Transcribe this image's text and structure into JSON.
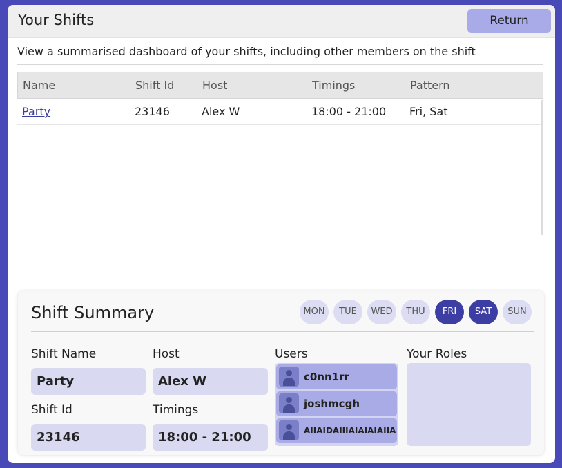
{
  "header": {
    "title": "Your Shifts",
    "return_label": "Return"
  },
  "subtitle": "View a summarised dashboard of your shifts, including other members on the shift",
  "table": {
    "columns": [
      "Name",
      "Shift Id",
      "Host",
      "Timings",
      "Pattern"
    ],
    "rows": [
      [
        "Party",
        "23146",
        "Alex W",
        "18:00 - 21:00",
        "Fri, Sat"
      ]
    ]
  },
  "summary": {
    "title": "Shift Summary",
    "days": [
      {
        "label": "MON",
        "active": false
      },
      {
        "label": "TUE",
        "active": false
      },
      {
        "label": "WED",
        "active": false
      },
      {
        "label": "THU",
        "active": false
      },
      {
        "label": "FRI",
        "active": true
      },
      {
        "label": "SAT",
        "active": true
      },
      {
        "label": "SUN",
        "active": false
      }
    ],
    "shift_name_label": "Shift Name",
    "shift_name": "Party",
    "host_label": "Host",
    "host": "Alex W",
    "shift_id_label": "Shift Id",
    "shift_id": "23146",
    "timings_label": "Timings",
    "timings": "18:00 - 21:00",
    "users_label": "Users",
    "users": [
      "c0nn1rr",
      "joshmcgh",
      "AIIAIDAIIIAIAIAIAIIA"
    ],
    "roles_label": "Your Roles"
  },
  "colors": {
    "background": "#4a49b8",
    "accent": "#a9abe8",
    "day_active": "#3c3ea3",
    "field": "#d9daf2"
  },
  "icons": {
    "user_avatar": "person-icon"
  }
}
